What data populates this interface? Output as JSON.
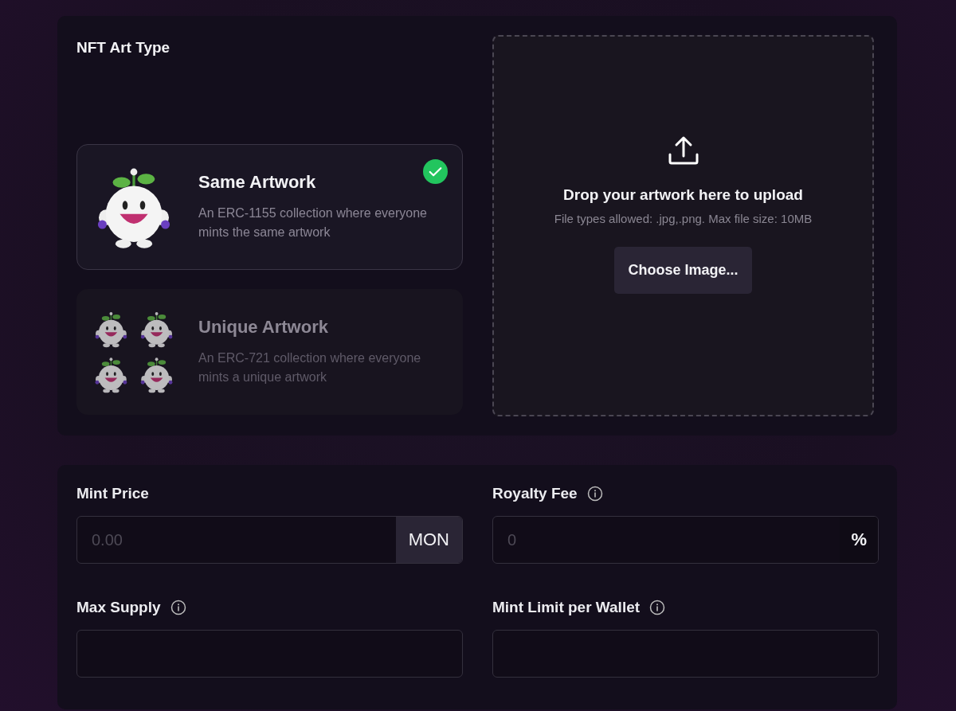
{
  "art_type": {
    "title": "NFT Art Type",
    "options": [
      {
        "kind": "single",
        "title": "Same Artwork",
        "description": "An ERC-1155 collection where everyone mints the same artwork",
        "selected": true
      },
      {
        "kind": "grid",
        "title": "Unique Artwork",
        "description": "An ERC-721 collection where everyone mints a unique artwork",
        "selected": false
      }
    ],
    "upload": {
      "title": "Drop your artwork here to upload",
      "hint": "File types allowed: .jpg,.png. Max file size: 10MB",
      "button": "Choose Image..."
    }
  },
  "settings": {
    "fields": [
      {
        "label": "Mint Price",
        "info": false,
        "placeholder": "0.00",
        "suffix": "MON",
        "kind": "filled"
      },
      {
        "label": "Royalty Fee",
        "info": true,
        "placeholder": "0",
        "suffix": "%",
        "kind": "plain"
      },
      {
        "label": "Max Supply",
        "info": true
      },
      {
        "label": "Mint Limit per Wallet",
        "info": true
      }
    ]
  }
}
